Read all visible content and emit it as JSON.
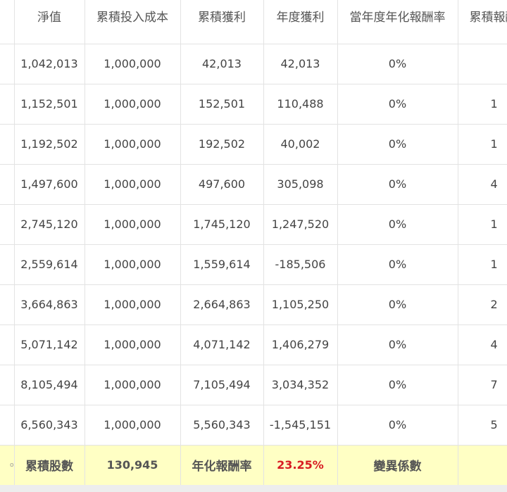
{
  "table": {
    "headers": [
      "",
      "淨值",
      "累積投入成本",
      "累積獲利",
      "年度獲利",
      "當年度年化報酬率",
      "累積報酬"
    ],
    "rows": [
      [
        "",
        "1,042,013",
        "1,000,000",
        "42,013",
        "42,013",
        "0%",
        ""
      ],
      [
        "",
        "1,152,501",
        "1,000,000",
        "152,501",
        "110,488",
        "0%",
        "1"
      ],
      [
        "",
        "1,192,502",
        "1,000,000",
        "192,502",
        "40,002",
        "0%",
        "1"
      ],
      [
        "",
        "1,497,600",
        "1,000,000",
        "497,600",
        "305,098",
        "0%",
        "4"
      ],
      [
        "",
        "2,745,120",
        "1,000,000",
        "1,745,120",
        "1,247,520",
        "0%",
        "1"
      ],
      [
        "",
        "2,559,614",
        "1,000,000",
        "1,559,614",
        "-185,506",
        "0%",
        "1"
      ],
      [
        "",
        "3,664,863",
        "1,000,000",
        "2,664,863",
        "1,105,250",
        "0%",
        "2"
      ],
      [
        "",
        "5,071,142",
        "1,000,000",
        "4,071,142",
        "1,406,279",
        "0%",
        "4"
      ],
      [
        "",
        "8,105,494",
        "1,000,000",
        "7,105,494",
        "3,034,352",
        "0%",
        "7"
      ],
      [
        "",
        "6,560,343",
        "1,000,000",
        "5,560,343",
        "-1,545,151",
        "0%",
        "5"
      ]
    ]
  },
  "summary": {
    "edge_text": "o",
    "shares_label": "累積股數",
    "shares_value": "130,945",
    "annual_return_label": "年化報酬率",
    "annual_return_value": "23.25%",
    "variation_label": "變異係數",
    "variation_value": ""
  },
  "colors": {
    "summary_background": "#ffffc4",
    "return_value": "#d81b22",
    "grid_line": "#e3e3e3"
  }
}
